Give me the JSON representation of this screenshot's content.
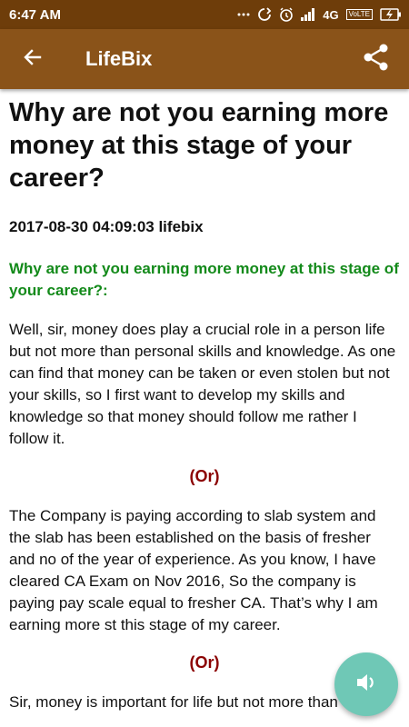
{
  "status_bar": {
    "time": "6:47 AM",
    "network": "4G",
    "volte": "VoLTE"
  },
  "app_bar": {
    "title": "LifeBix",
    "back_icon": "arrow-back-icon",
    "share_icon": "share-icon"
  },
  "article": {
    "title": "Why are not you earning more money at this stage of your career?",
    "meta": "2017-08-30 04:09:03 lifebix",
    "subheading": "Why are not you earning more money at this stage of your career?:",
    "paragraphs": [
      "Well, sir, money does play a crucial role in a person life but not more than personal skills and knowledge. As one can find that money can be taken or even stolen but not your skills, so I first want to develop my skills and knowledge so that money should follow me rather I follow it.",
      "The Company is paying according to slab system and the slab has been established on the basis of fresher and no of the year of experience. As you know, I have cleared CA Exam on Nov 2016, So the company is paying pay scale equal to fresher CA. That’s why I am earning more st this stage of my career.",
      "Sir, money is important for life but not more than"
    ],
    "separator": "(Or)"
  },
  "fab": {
    "icon": "speaker-icon"
  },
  "colors": {
    "status_bar": "#6e3d0a",
    "app_bar": "#8a5319",
    "subheading": "#138a1a",
    "separator": "#8b0000",
    "fab": "#6fc8b6"
  }
}
